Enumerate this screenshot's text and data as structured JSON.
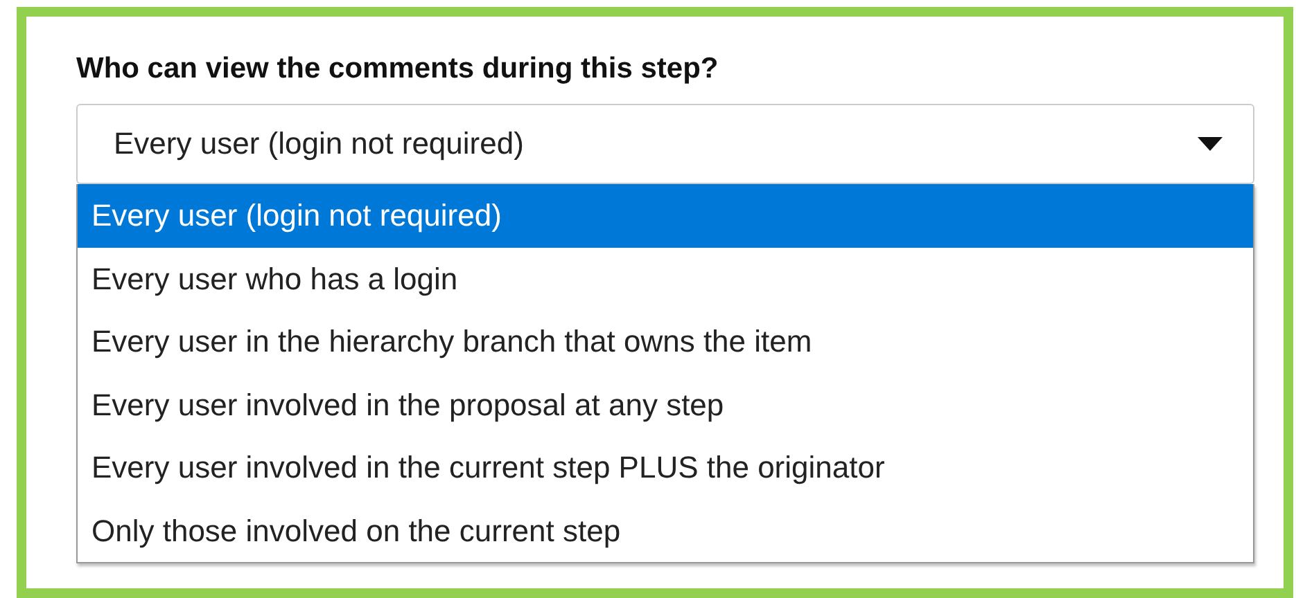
{
  "question": "Who can view the comments during this step?",
  "select": {
    "value": "Every user (login not required)",
    "expanded": true
  },
  "options": [
    {
      "label": "Every user (login not required)",
      "selected": true
    },
    {
      "label": "Every user who has a login",
      "selected": false
    },
    {
      "label": "Every user in the hierarchy branch that owns the item",
      "selected": false
    },
    {
      "label": "Every user involved in the proposal at any step",
      "selected": false
    },
    {
      "label": "Every user involved in the current step PLUS the originator",
      "selected": false
    },
    {
      "label": "Only those involved on the current step",
      "selected": false
    }
  ]
}
